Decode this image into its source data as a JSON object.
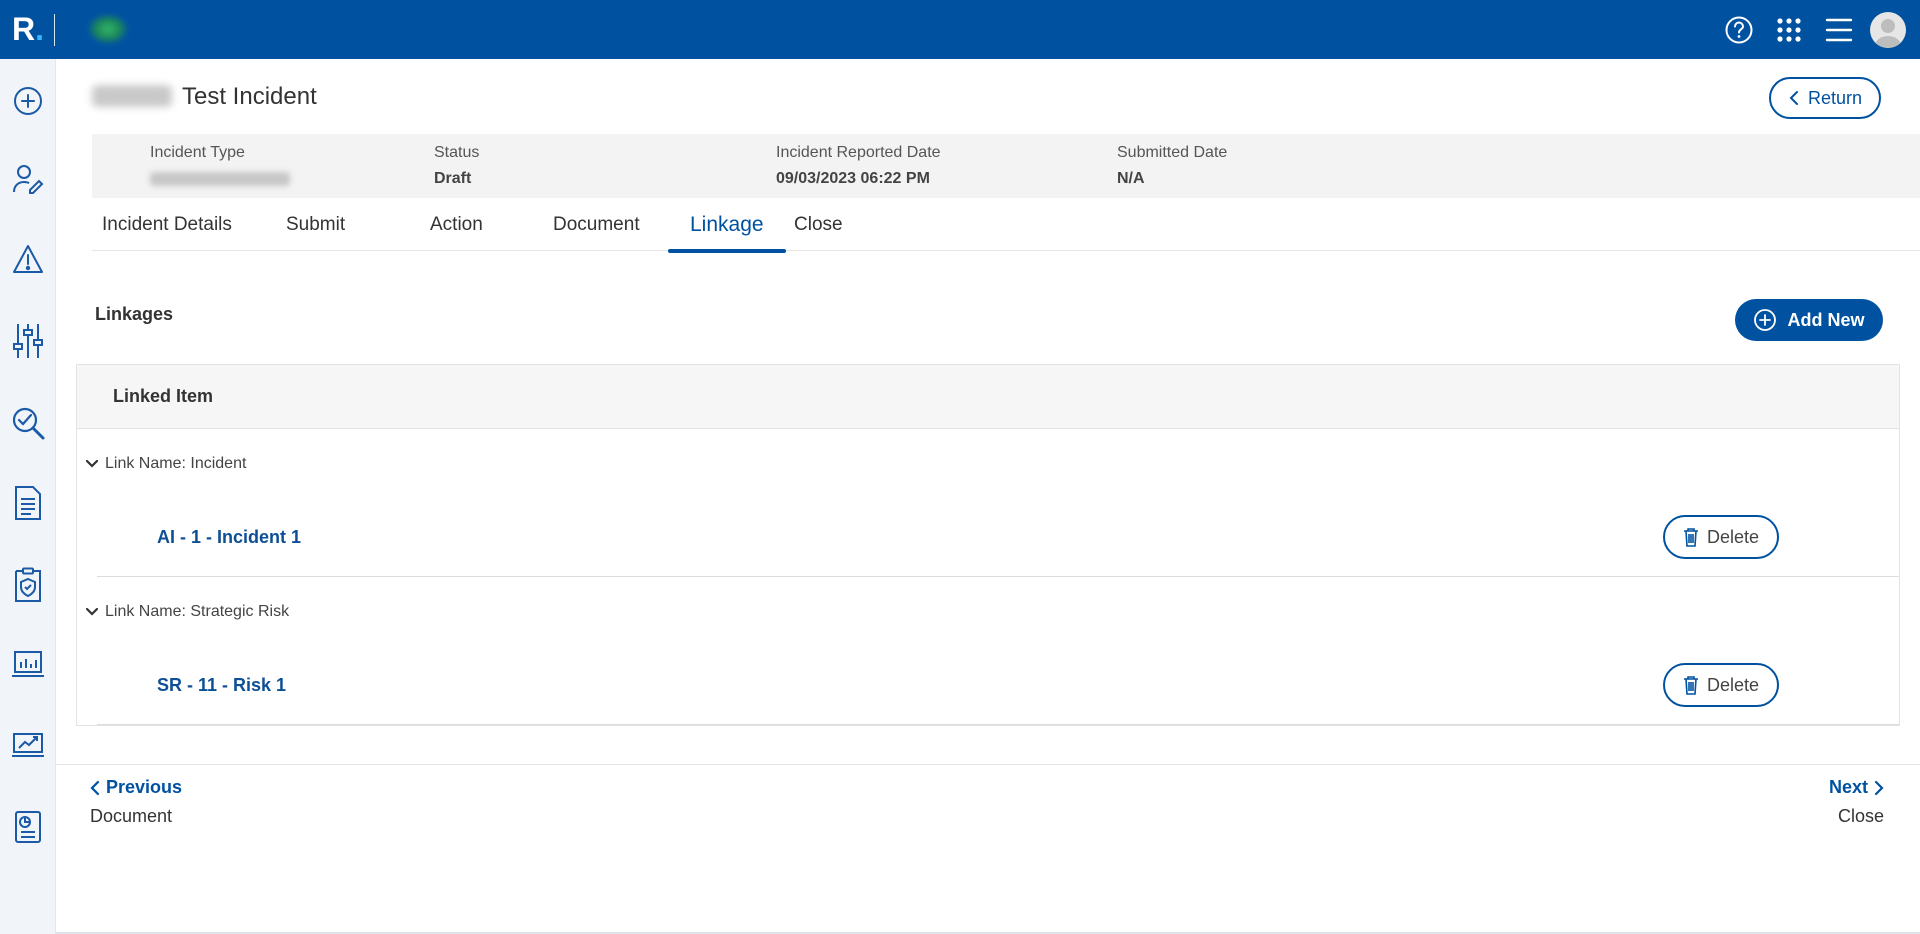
{
  "app": {
    "logo_letter": "R",
    "logo_dot": ".",
    "accent": "#0052a1"
  },
  "topbar": {
    "icons": [
      "help-icon",
      "apps-grid-icon",
      "menu-icon",
      "user-avatar"
    ]
  },
  "sidebar": {
    "icons": [
      "add-circle-icon",
      "user-edit-icon",
      "warning-icon",
      "sliders-icon",
      "audit-search-icon",
      "document-icon",
      "shield-document-icon",
      "dashboard-icon",
      "chart-icon",
      "report-icon"
    ]
  },
  "header": {
    "title": "Test Incident",
    "return_label": "Return"
  },
  "meta": {
    "incident_type_label": "Incident Type",
    "status_label": "Status",
    "status_value": "Draft",
    "reported_label": "Incident Reported Date",
    "reported_value": "09/03/2023 06:22 PM",
    "submitted_label": "Submitted Date",
    "submitted_value": "N/A"
  },
  "tabs": [
    {
      "label": "Incident Details"
    },
    {
      "label": "Submit"
    },
    {
      "label": "Action"
    },
    {
      "label": "Document"
    },
    {
      "label": "Linkage",
      "active": true
    },
    {
      "label": "Close"
    }
  ],
  "linkages": {
    "title": "Linkages",
    "add_label": "Add New",
    "column_header": "Linked Item",
    "groups": [
      {
        "label": "Link Name: Incident",
        "item": "AI - 1 - Incident 1",
        "delete_label": "Delete"
      },
      {
        "label": "Link Name: Strategic Risk",
        "item": "SR - 11 - Risk 1",
        "delete_label": "Delete"
      }
    ]
  },
  "pager": {
    "previous_label": "Previous",
    "previous_sub": "Document",
    "next_label": "Next",
    "next_sub": "Close"
  }
}
